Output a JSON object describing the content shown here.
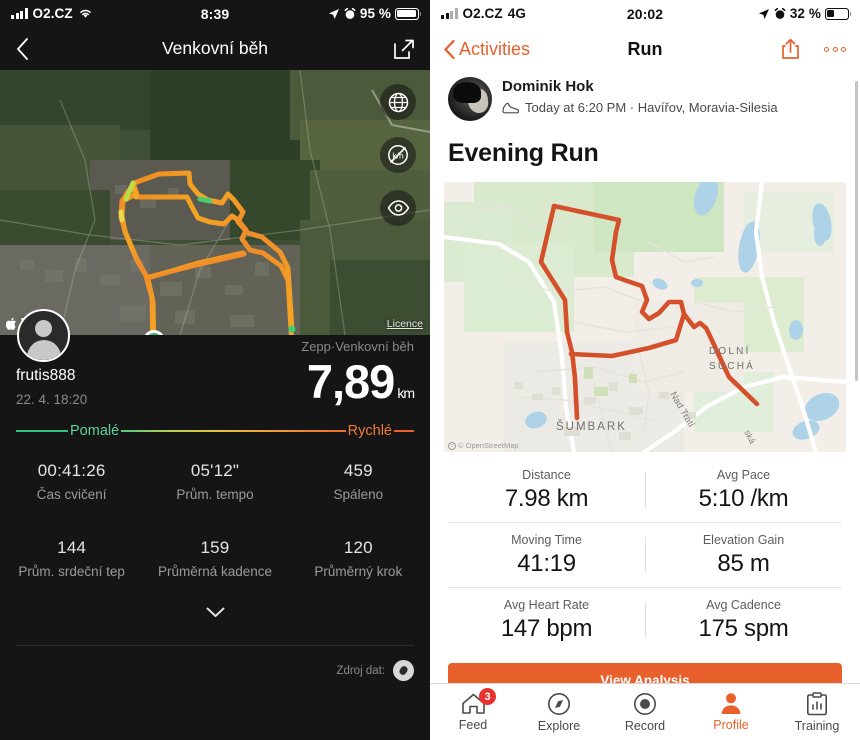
{
  "left": {
    "status": {
      "carrier": "O2.CZ",
      "wifi_icon": "wifi-icon",
      "time": "8:39",
      "battery_pct": "95 %",
      "location_icon": "location-arrow-icon",
      "alarm_icon": "alarm-clock-icon"
    },
    "nav": {
      "back_icon": "chevron-left-icon",
      "title": "Venkovní běh",
      "share_icon": "external-link-icon"
    },
    "map": {
      "type": "satellite",
      "attribution": "Mapy",
      "attribution_brand_icon": "apple-logo-icon",
      "licence_label": "Licence",
      "start_marker": "start-marker",
      "controls": [
        {
          "name": "globe-icon",
          "label": "globe"
        },
        {
          "name": "speed-off-icon",
          "label": "km/h slashed"
        },
        {
          "name": "eye-icon",
          "label": "eye"
        }
      ]
    },
    "summary": {
      "username": "frutis888",
      "date": "22. 4. 18:20",
      "source": "Zepp·Venkovní běh",
      "distance": "7,89",
      "distance_unit": "km"
    },
    "pace_legend": {
      "slow": "Pomalé",
      "fast": "Rychlé",
      "slow_color": "#5fd19a",
      "fast_color": "#ef7a3a"
    },
    "stats": [
      {
        "value": "00:41:26",
        "label": "Čas cvičení"
      },
      {
        "value": "05'12\"",
        "label": "Prům. tempo"
      },
      {
        "value": "459",
        "label": "Spáleno"
      },
      {
        "value": "144",
        "label": "Prům. srdeční tep"
      },
      {
        "value": "159",
        "label": "Průměrná kadence"
      },
      {
        "value": "120",
        "label": "Průměrný krok"
      }
    ],
    "expand_icon": "chevron-down-icon",
    "source_row": {
      "label": "Zdroj dat:",
      "badge_icon": "device-badge-icon"
    }
  },
  "right": {
    "status": {
      "carrier": "O2.CZ",
      "network": "4G",
      "time": "20:02",
      "battery_pct": "32 %",
      "location_icon": "location-arrow-icon",
      "alarm_icon": "alarm-clock-icon"
    },
    "nav": {
      "back_icon": "chevron-left-icon",
      "back_label": "Activities",
      "title": "Run",
      "share_icon": "share-up-icon",
      "more_icon": "more-dots-icon"
    },
    "user": {
      "name": "Dominik Hok",
      "meta": "Today at 6:20 PM · Havířov, Moravia-Silesia",
      "activity_icon": "running-shoe-icon",
      "avatar": "avatar"
    },
    "activity_title": "Evening Run",
    "map": {
      "type": "street",
      "labels": [
        "ŠUMBARK",
        "DOLNÍ SUCHÁ",
        "Nad Tratí"
      ],
      "route_color": "#d4502a",
      "attribution": "© OpenStreetMap"
    },
    "stats": [
      [
        {
          "label": "Distance",
          "value": "7.98 km"
        },
        {
          "label": "Avg Pace",
          "value": "5:10 /km"
        }
      ],
      [
        {
          "label": "Moving Time",
          "value": "41:19"
        },
        {
          "label": "Elevation Gain",
          "value": "85 m"
        }
      ],
      [
        {
          "label": "Avg Heart Rate",
          "value": "147 bpm"
        },
        {
          "label": "Avg Cadence",
          "value": "175 spm"
        }
      ]
    ],
    "analysis_button": "View Analysis",
    "accent_color": "#e8602c",
    "tabs": [
      {
        "label": "Feed",
        "icon": "home-icon",
        "badge": "3",
        "active": false
      },
      {
        "label": "Explore",
        "icon": "compass-icon",
        "badge": "",
        "active": false
      },
      {
        "label": "Record",
        "icon": "record-icon",
        "badge": "",
        "active": false
      },
      {
        "label": "Profile",
        "icon": "person-icon",
        "badge": "",
        "active": true
      },
      {
        "label": "Training",
        "icon": "clipboard-chart-icon",
        "badge": "",
        "active": false
      }
    ]
  }
}
